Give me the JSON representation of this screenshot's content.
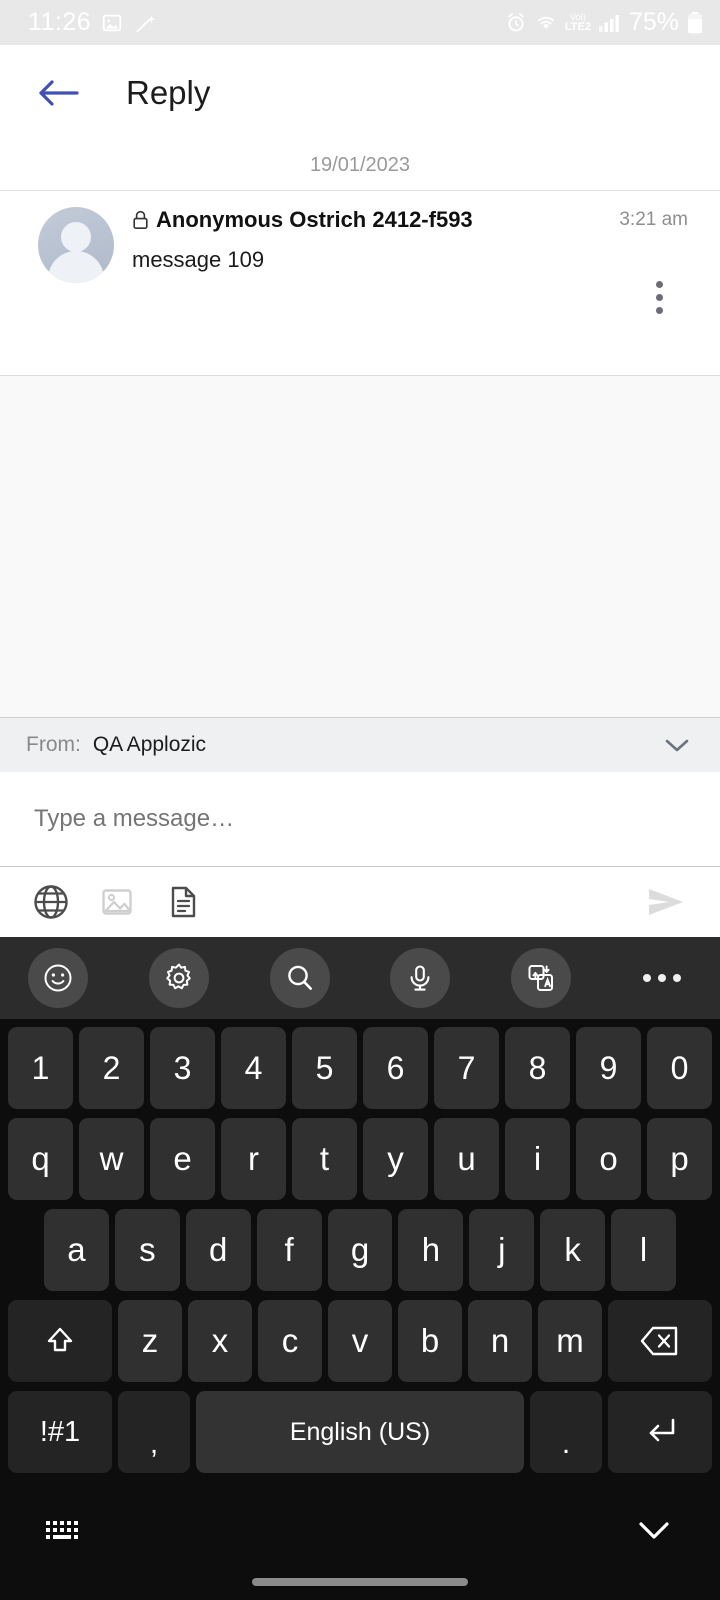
{
  "statusbar": {
    "time": "11:26",
    "icons_left": [
      "image-icon",
      "magic-wand-icon"
    ],
    "alarm_icon": "alarm-icon",
    "wifi_icon": "wifi-icon",
    "network_label_top": "VoI)",
    "network_label_bottom": "LTE2",
    "signal_icon": "signal-bars-icon",
    "battery_text": "75%",
    "battery_icon": "battery-icon",
    "bg_color": "#e8e8e8",
    "fg_color": "#ffffff"
  },
  "header": {
    "back_icon": "back-arrow-icon",
    "back_color": "#3f51b5",
    "title": "Reply"
  },
  "conversation": {
    "date_divider": "19/01/2023",
    "message": {
      "avatar": "default-avatar-icon",
      "lock_icon": "lock-icon",
      "sender": "Anonymous Ostrich 2412-f593",
      "time": "3:21 am",
      "text": "message 109",
      "menu_icon": "overflow-menu-icon"
    },
    "empty_bg": "#f9f9f9"
  },
  "from_bar": {
    "label": "From:",
    "value": "QA Applozic",
    "chevron_icon": "chevron-down-icon"
  },
  "composer": {
    "placeholder": "Type a message…",
    "value": ""
  },
  "attachments": {
    "items": [
      {
        "name": "globe-icon",
        "label": "Web link"
      },
      {
        "name": "image-icon",
        "label": "Image"
      },
      {
        "name": "document-icon",
        "label": "Document"
      }
    ],
    "send_icon": "send-icon",
    "send_color": "#dcdcdc"
  },
  "keyboard": {
    "toolbar": [
      {
        "icon": "emoji-icon"
      },
      {
        "icon": "settings-gear-icon"
      },
      {
        "icon": "search-icon"
      },
      {
        "icon": "microphone-icon"
      },
      {
        "icon": "translate-icon"
      },
      {
        "icon": "more-horizontal-icon"
      }
    ],
    "rows": {
      "numbers": [
        "1",
        "2",
        "3",
        "4",
        "5",
        "6",
        "7",
        "8",
        "9",
        "0"
      ],
      "top": [
        "q",
        "w",
        "e",
        "r",
        "t",
        "y",
        "u",
        "i",
        "o",
        "p"
      ],
      "home": [
        "a",
        "s",
        "d",
        "f",
        "g",
        "h",
        "j",
        "k",
        "l"
      ],
      "bottom": [
        "z",
        "x",
        "c",
        "v",
        "b",
        "n",
        "m"
      ]
    },
    "shift_icon": "shift-arrow-icon",
    "backspace_icon": "backspace-icon",
    "symbols_label": "!#1",
    "comma_label": ",",
    "space_label": "English (US)",
    "period_label": ".",
    "enter_icon": "enter-return-icon",
    "switch_icon": "keyboard-switch-icon",
    "hide_icon": "chevron-down-icon",
    "bg_color": "#0d0d0d",
    "key_color": "#303030",
    "toolbar_bg": "#2c2c2c"
  }
}
